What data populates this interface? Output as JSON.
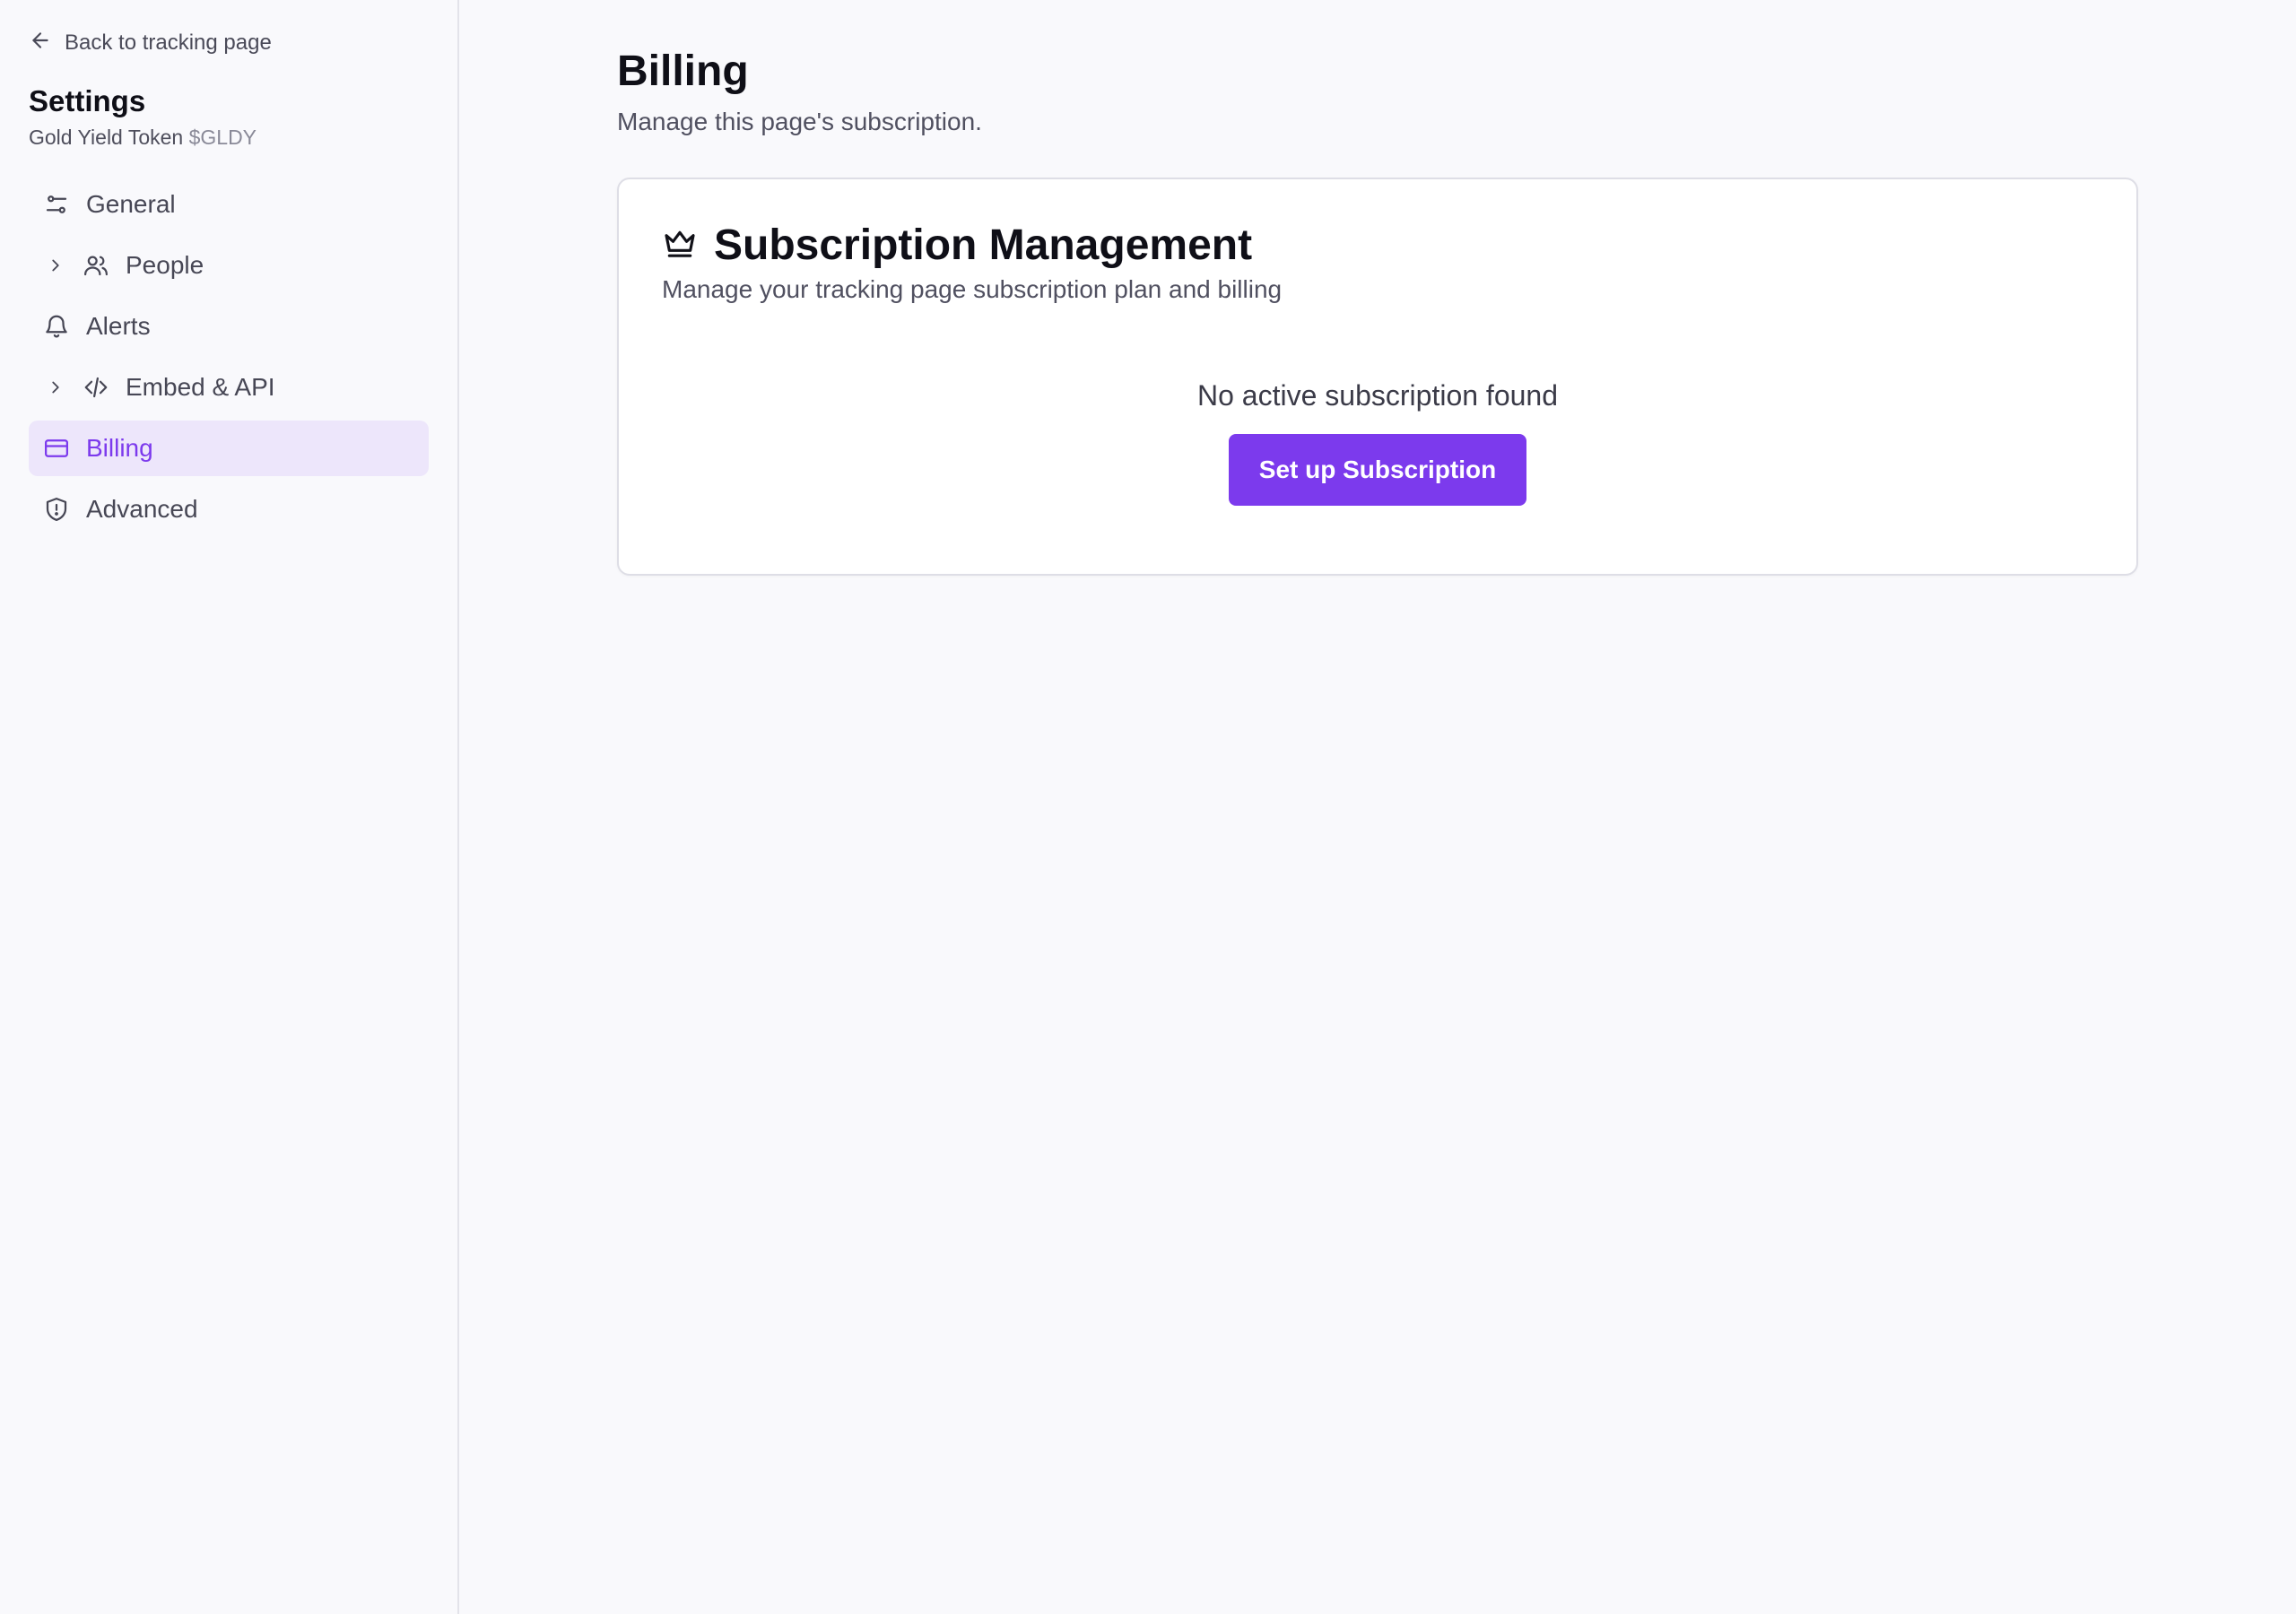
{
  "sidebar": {
    "back_label": "Back to tracking page",
    "title": "Settings",
    "project_name": "Gold Yield Token",
    "project_ticker": "$GLDY",
    "items": [
      {
        "label": "General",
        "icon": "sliders-icon",
        "expandable": false,
        "active": false
      },
      {
        "label": "People",
        "icon": "users-icon",
        "expandable": true,
        "active": false
      },
      {
        "label": "Alerts",
        "icon": "bell-icon",
        "expandable": false,
        "active": false
      },
      {
        "label": "Embed & API",
        "icon": "code-icon",
        "expandable": true,
        "active": false
      },
      {
        "label": "Billing",
        "icon": "credit-card-icon",
        "expandable": false,
        "active": true
      },
      {
        "label": "Advanced",
        "icon": "shield-alert-icon",
        "expandable": false,
        "active": false
      }
    ]
  },
  "main": {
    "title": "Billing",
    "subtitle": "Manage this page's subscription.",
    "card": {
      "icon": "crown-icon",
      "title": "Subscription Management",
      "description": "Manage your tracking page subscription plan and billing",
      "empty_text": "No active subscription found",
      "cta_label": "Set up Subscription"
    }
  },
  "colors": {
    "accent": "#7c3aed",
    "active_bg": "#ede6fb",
    "page_bg": "#f9f9fc"
  }
}
